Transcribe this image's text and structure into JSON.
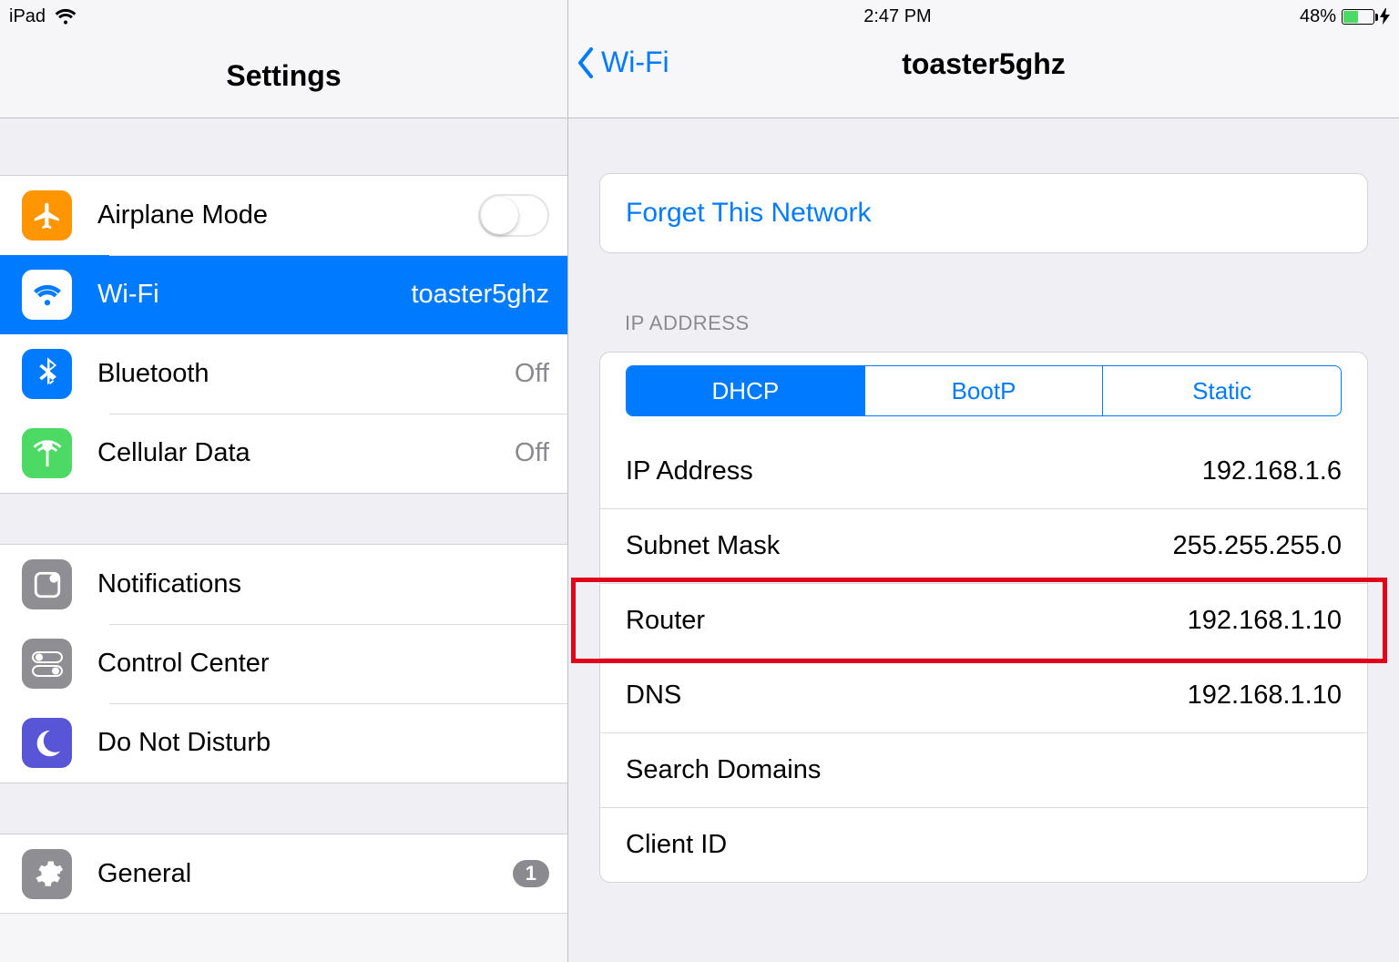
{
  "statusbar": {
    "device": "iPad",
    "time": "2:47 PM",
    "battery_pct": "48%",
    "battery_fill_pct": 48
  },
  "sidebar": {
    "title": "Settings",
    "groups": [
      {
        "items": [
          {
            "label": "Airplane Mode",
            "trailing": "",
            "toggle": true
          },
          {
            "label": "Wi-Fi",
            "trailing": "toaster5ghz",
            "selected": true
          },
          {
            "label": "Bluetooth",
            "trailing": "Off"
          },
          {
            "label": "Cellular Data",
            "trailing": "Off"
          }
        ]
      },
      {
        "items": [
          {
            "label": "Notifications"
          },
          {
            "label": "Control Center"
          },
          {
            "label": "Do Not Disturb"
          }
        ]
      },
      {
        "items": [
          {
            "label": "General",
            "badge": "1"
          }
        ]
      }
    ]
  },
  "detail": {
    "back_label": "Wi-Fi",
    "title": "toaster5ghz",
    "forget": "Forget This Network",
    "ip_section_label": "IP ADDRESS",
    "segments": [
      "DHCP",
      "BootP",
      "Static"
    ],
    "segment_active_index": 0,
    "rows": [
      {
        "label": "IP Address",
        "value": "192.168.1.6"
      },
      {
        "label": "Subnet Mask",
        "value": "255.255.255.0"
      },
      {
        "label": "Router",
        "value": "192.168.1.10"
      },
      {
        "label": "DNS",
        "value": "192.168.1.10"
      },
      {
        "label": "Search Domains",
        "value": ""
      },
      {
        "label": "Client ID",
        "value": ""
      }
    ],
    "highlighted_row_index": 2
  }
}
